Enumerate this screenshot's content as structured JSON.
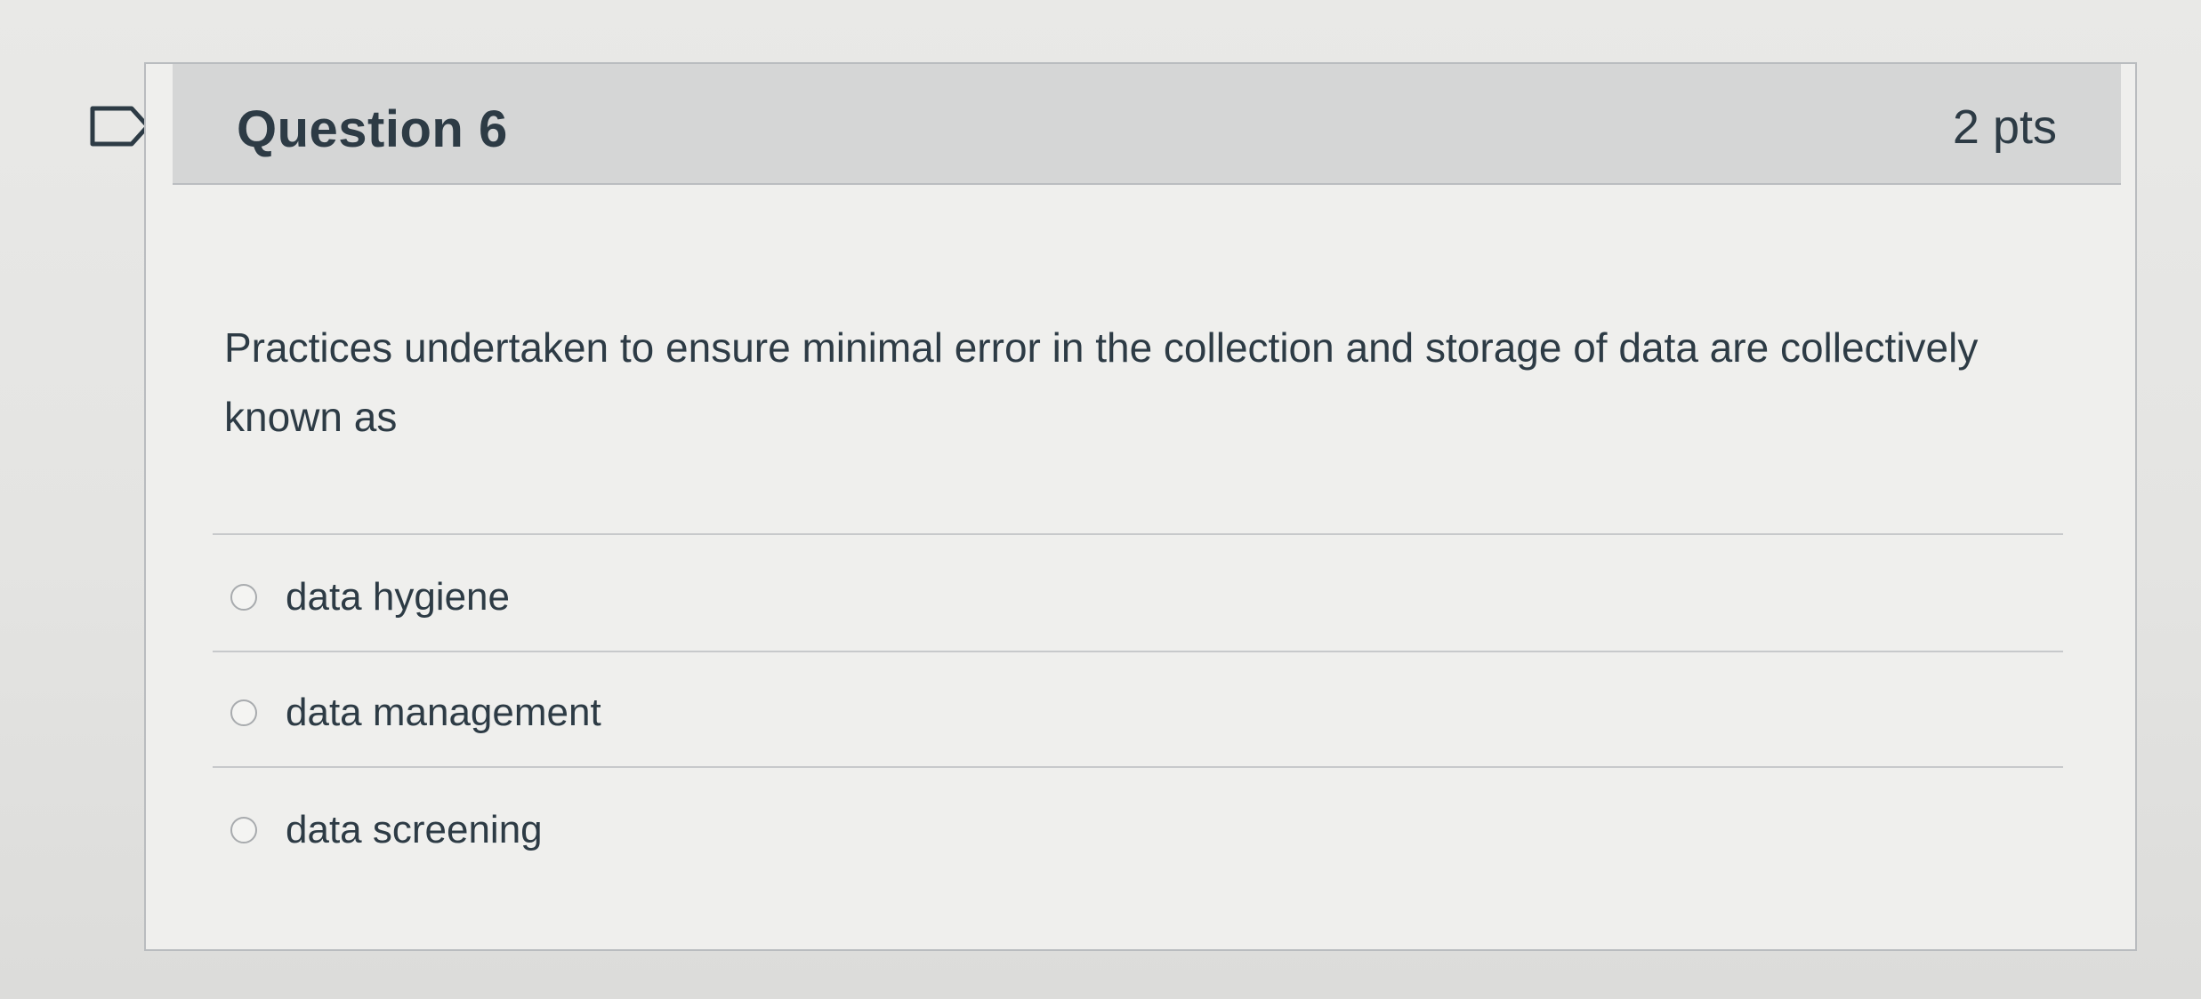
{
  "question": {
    "title": "Question 6",
    "points": "2 pts",
    "text": "Practices undertaken to ensure minimal error in the collection and storage of data are collectively known as",
    "answers": [
      {
        "label": "data hygiene",
        "selected": false
      },
      {
        "label": "data management",
        "selected": false
      },
      {
        "label": "data screening",
        "selected": false
      }
    ]
  },
  "icons": {
    "flag": "flag-outline-icon",
    "radio": "radio-unchecked-icon"
  },
  "colors": {
    "header_bg": "#d5d6d6",
    "body_bg": "#efefed",
    "text": "#2d3b45"
  }
}
